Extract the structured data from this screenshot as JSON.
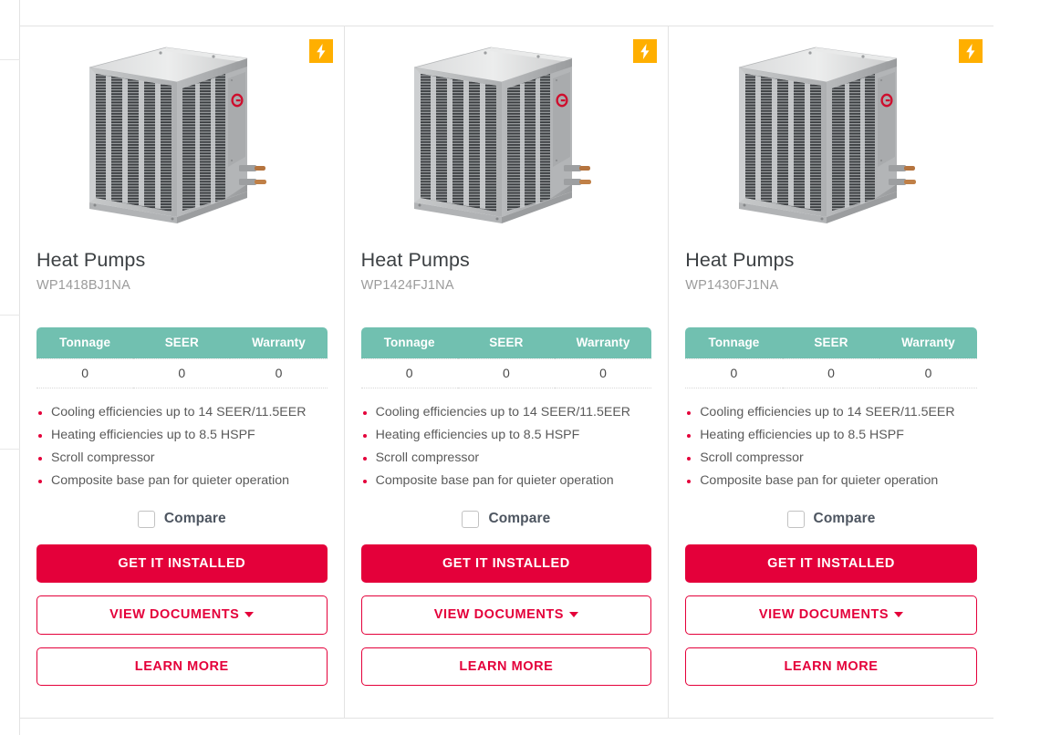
{
  "page": {
    "background": "#ffffff",
    "accent_red": "#E4003A",
    "accent_teal": "#71C0B0",
    "badge_orange": "#FFAF00"
  },
  "left_rail": {
    "divider_positions": [
      93,
      373,
      520
    ]
  },
  "badge": {
    "icon": "lightning-bolt-icon",
    "color": "#FFAF00"
  },
  "spec_headers": [
    "Tonnage",
    "SEER",
    "Warranty"
  ],
  "compare_label": "Compare",
  "buttons": {
    "primary": "GET IT INSTALLED",
    "documents": "VIEW DOCUMENTS",
    "learn_more": "LEARN MORE"
  },
  "products": [
    {
      "category": "Heat Pumps",
      "model": "WP1418BJ1NA",
      "image": "rheem-heat-pump-condenser-unit",
      "specs": {
        "tonnage": "0",
        "seer": "0",
        "warranty": "0"
      },
      "features": [
        "Cooling efficiencies up to 14 SEER/11.5EER",
        "Heating efficiencies up to 8.5 HSPF",
        "Scroll compressor",
        "Composite base pan for quieter operation"
      ]
    },
    {
      "category": "Heat Pumps",
      "model": "WP1424FJ1NA",
      "image": "rheem-heat-pump-condenser-unit",
      "specs": {
        "tonnage": "0",
        "seer": "0",
        "warranty": "0"
      },
      "features": [
        "Cooling efficiencies up to 14 SEER/11.5EER",
        "Heating efficiencies up to 8.5 HSPF",
        "Scroll compressor",
        "Composite base pan for quieter operation"
      ]
    },
    {
      "category": "Heat Pumps",
      "model": "WP1430FJ1NA",
      "image": "rheem-heat-pump-condenser-unit",
      "specs": {
        "tonnage": "0",
        "seer": "0",
        "warranty": "0"
      },
      "features": [
        "Cooling efficiencies up to 14 SEER/11.5EER",
        "Heating efficiencies up to 8.5 HSPF",
        "Scroll compressor",
        "Composite base pan for quieter operation"
      ]
    }
  ]
}
